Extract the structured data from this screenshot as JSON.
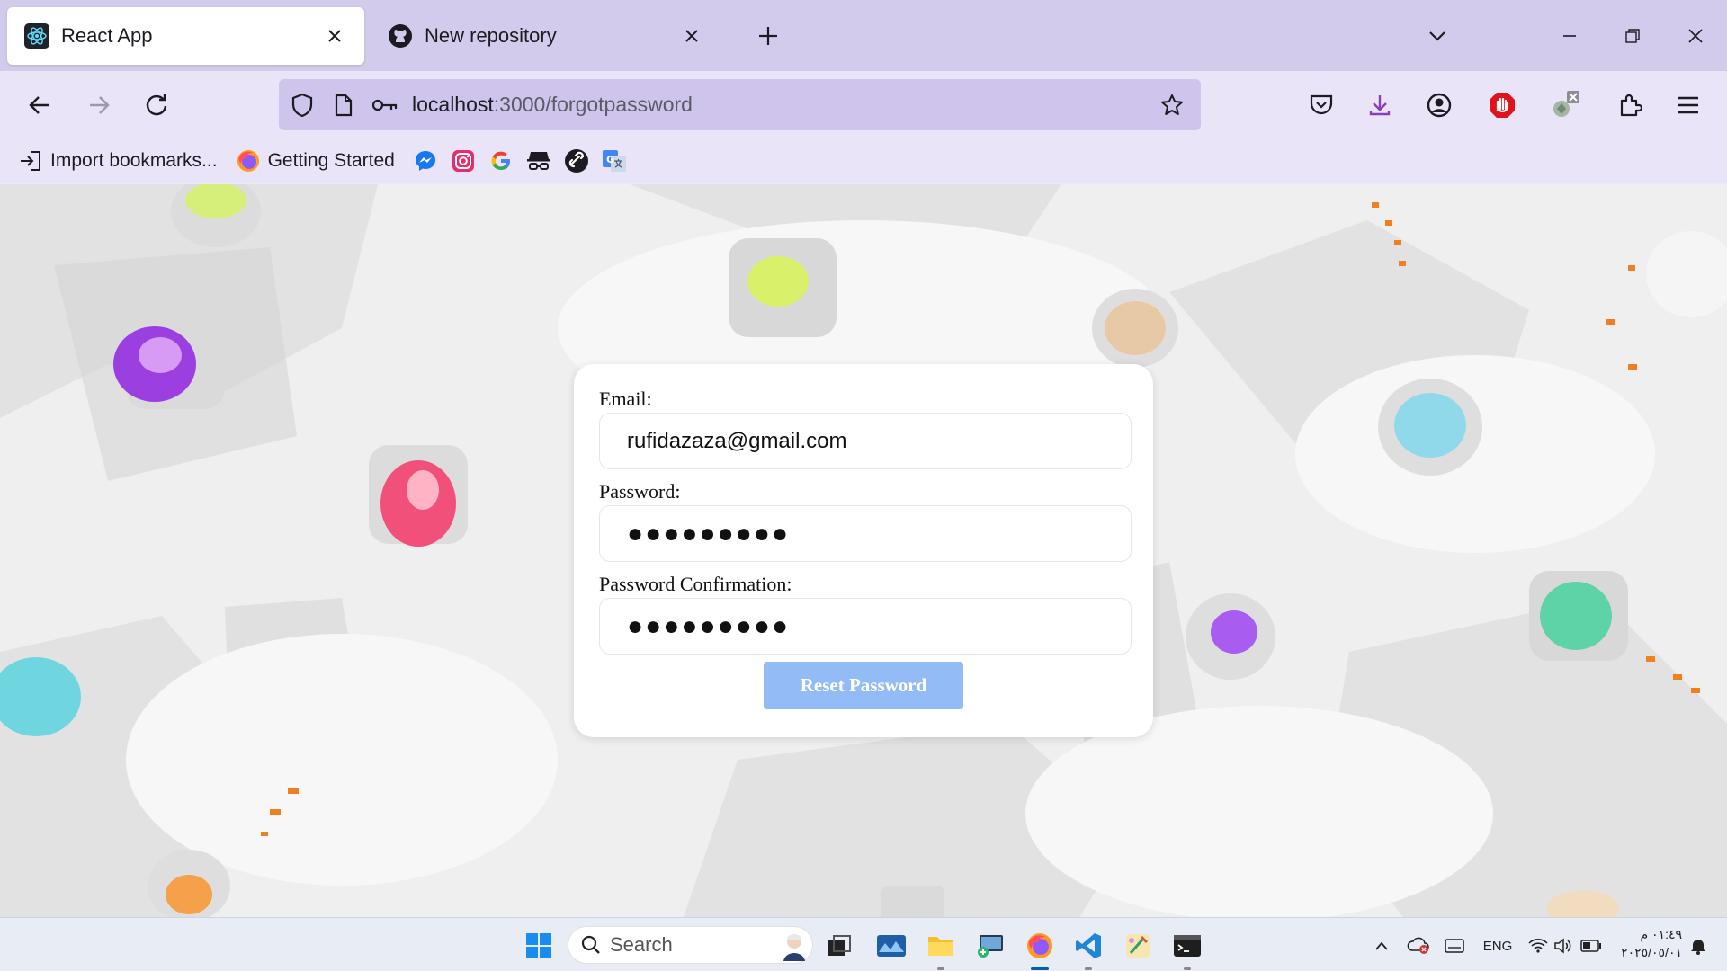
{
  "browser": {
    "tabs": [
      {
        "title": "React App",
        "icon": "react-icon",
        "active": true
      },
      {
        "title": "New repository",
        "icon": "github-icon",
        "active": false
      }
    ],
    "url": {
      "host": "localhost",
      "path": ":3000/forgotpassword"
    }
  },
  "bookmarks": [
    {
      "label": "Import bookmarks...",
      "icon": "import-icon"
    },
    {
      "label": "Getting Started",
      "icon": "firefox-icon"
    },
    {
      "label": "",
      "icon": "messenger-icon"
    },
    {
      "label": "",
      "icon": "instagram-icon"
    },
    {
      "label": "",
      "icon": "google-icon"
    },
    {
      "label": "",
      "icon": "incognito-icon"
    },
    {
      "label": "",
      "icon": "link-icon"
    },
    {
      "label": "",
      "icon": "translate-icon"
    }
  ],
  "form": {
    "email_label": "Email:",
    "email_value": "rufidazaza@gmail.com",
    "password_label": "Password:",
    "password_value": "●●●●●●●●●",
    "confirm_label": "Password Confirmation:",
    "confirm_value": "●●●●●●●●●",
    "submit_label": "Reset Password"
  },
  "taskbar": {
    "search_label": "Search",
    "language": "ENG",
    "time": "٠١:٤٩ م",
    "date": "٢٠٢٥/٠٥/٠١"
  },
  "colors": {
    "tabstrip": "#d3cbeb",
    "navbar": "#e9e4f7",
    "button": "#93bbf6"
  }
}
